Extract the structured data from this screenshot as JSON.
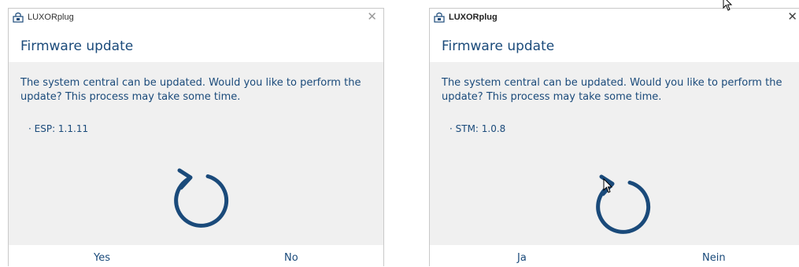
{
  "colors": {
    "accent": "#1a4a7a",
    "content_bg": "#f0f0f0",
    "border": "#c9c9c9"
  },
  "dialogs": [
    {
      "app_title": "LUXORplug",
      "close_glyph": "✕",
      "header_title": "Firmware update",
      "message": "The system central can be updated. Would you like to perform the update? This process may take some time.",
      "version_line": "· ESP: 1.1.11",
      "spinner_icon": "refresh-icon",
      "yes_label": "Yes",
      "no_label": "No"
    },
    {
      "app_title": "LUXORplug",
      "close_glyph": "✕",
      "header_title": "Firmware update",
      "message": "The system central can be updated. Would you like to perform the update? This process may take some time.",
      "version_line": "· STM: 1.0.8",
      "spinner_icon": "refresh-icon",
      "yes_label": "Ja",
      "no_label": "Nein"
    }
  ]
}
